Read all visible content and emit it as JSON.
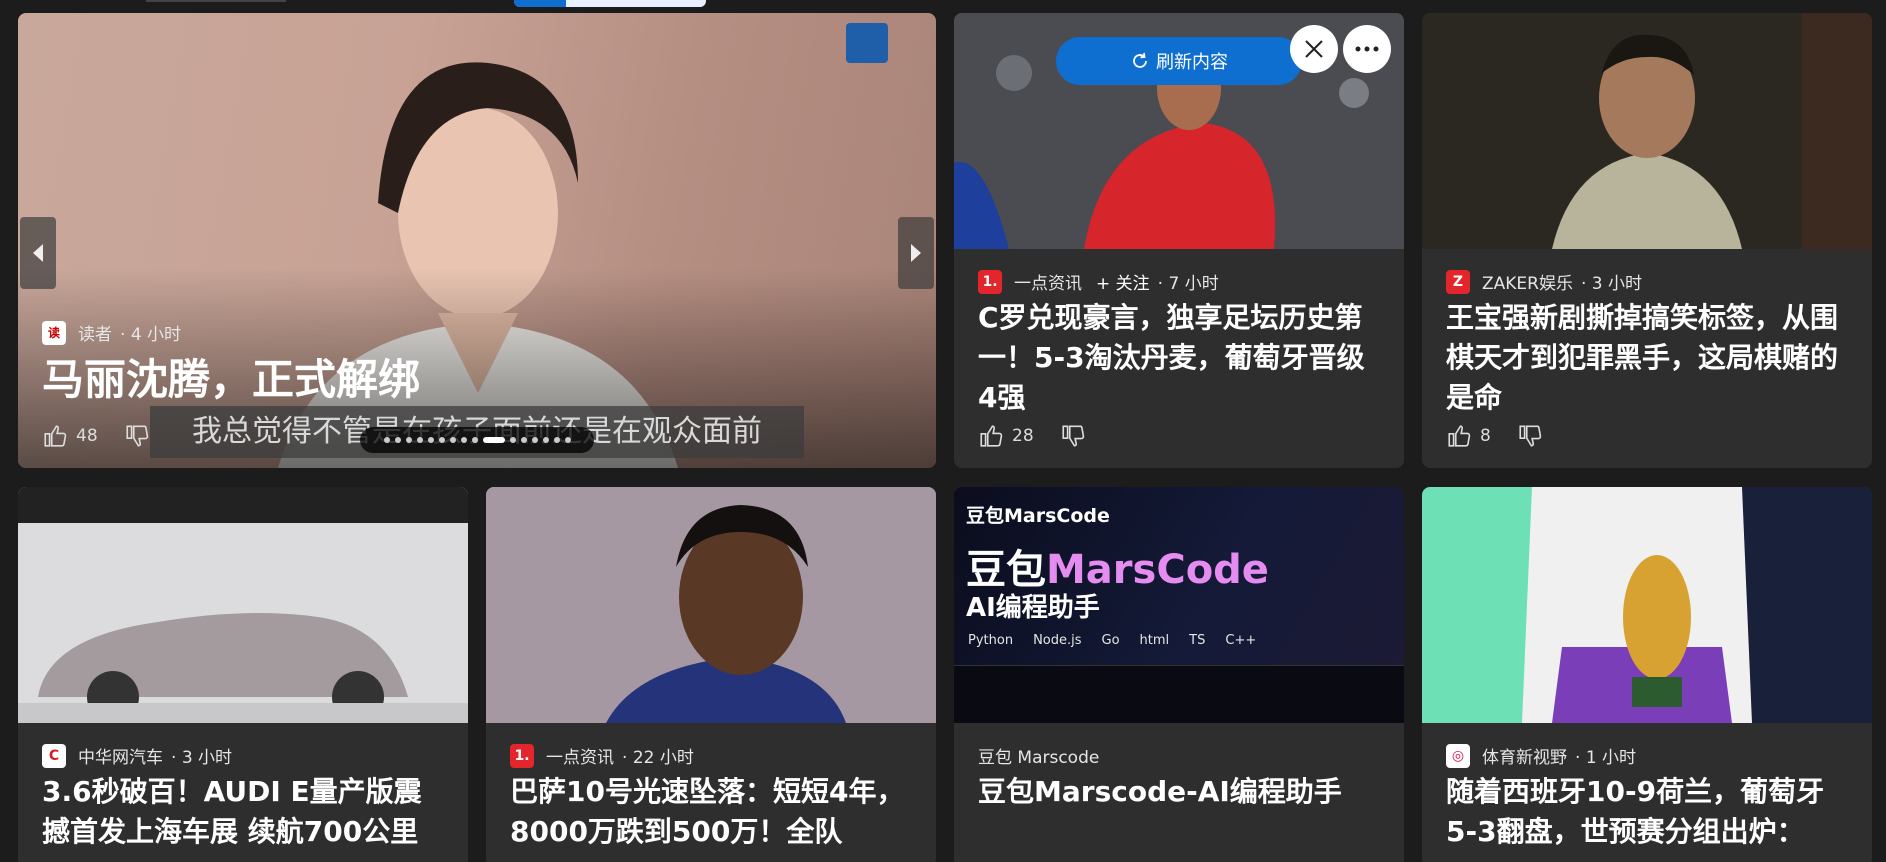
{
  "hero": {
    "source": "读者",
    "time": "4 小时",
    "title": "马丽沈腾，正式解绑",
    "subtitle": "我总觉得不管是在孩子面前还是在观众面前",
    "likes": "48",
    "total_slides": 16,
    "active_slide": 10
  },
  "toolbar": {
    "refresh_label": "刷新内容"
  },
  "cards": [
    {
      "source": "一点资讯",
      "follow": "+ 关注",
      "time": "7 小时",
      "title": "C罗兑现豪言，独享足坛历史第一！5-3淘汰丹麦，葡萄牙晋级4强",
      "likes": "28",
      "logo_text": "1.",
      "logo_color": "#e3262b"
    },
    {
      "source": "ZAKER娱乐",
      "time": "3 小时",
      "title": "王宝强新剧撕掉搞笑标签，从围棋天才到犯罪黑手，这局棋赌的是命",
      "likes": "8",
      "logo_text": "Z",
      "logo_color": "#e3262b"
    },
    {
      "source": "中华网汽车",
      "time": "3 小时",
      "title": "3.6秒破百！AUDI E量产版震撼首发上海车展 续航700公里",
      "logo_text": "C",
      "logo_color": "#ffffff"
    },
    {
      "source": "一点资讯",
      "time": "22 小时",
      "title": "巴萨10号光速坠落：短短4年，8000万跌到500万！全队",
      "logo_text": "1.",
      "logo_color": "#e3262b"
    },
    {
      "source": "豆包 Marscode",
      "title": "豆包Marscode-AI编程助手",
      "ad": {
        "brand": "豆包MarsCode",
        "headline_a": "豆包",
        "headline_b": "MarsCode",
        "subline": "AI编程助手",
        "langs": [
          "Python",
          "Node.js",
          "Go",
          "html",
          "TS",
          "C++"
        ]
      }
    },
    {
      "source": "体育新视野",
      "time": "1 小时",
      "title": "随着西班牙10-9荷兰，葡萄牙5-3翻盘，世预赛分组出炉：",
      "logo_text": "◎",
      "logo_color": "#ffffff"
    }
  ],
  "colors": {
    "background": "#1c1c1c",
    "card": "#2e2e2e",
    "accent": "#0e6fd1"
  }
}
